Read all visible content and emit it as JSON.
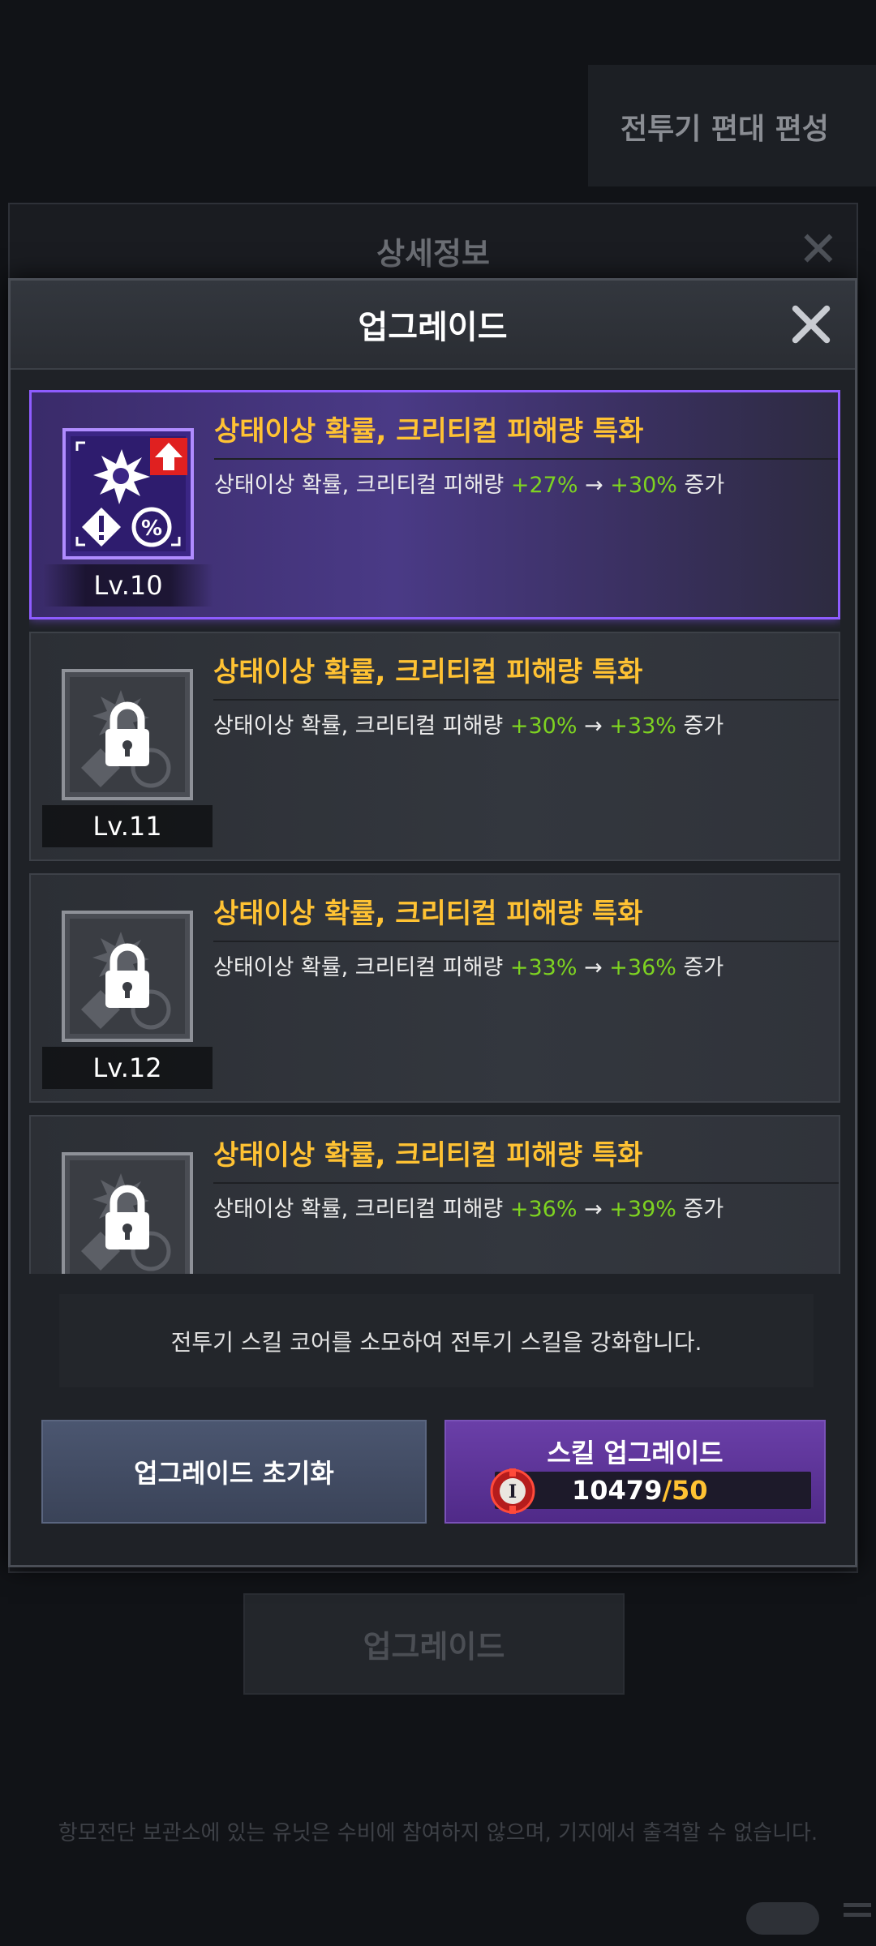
{
  "background": {
    "tabs": [
      "전투기 편대 편성"
    ],
    "detail_title": "상세정보",
    "upgrade_button": "업그레이드",
    "footer_note": "항모전단 보관소에 있는 유닛은 수비에 참여하지 않으며, 기지에서 출격할 수 없습니다."
  },
  "modal": {
    "title": "업그레이드",
    "cards": [
      {
        "title": "상태이상 확률, 크리티컬 피해량 특화",
        "desc_prefix": "상태이상 확률, 크리티컬 피해량 ",
        "from": "+27%",
        "arrow": "→",
        "to": "+30%",
        "desc_suffix": " 증가",
        "level": "Lv.10",
        "state": "unlocked"
      },
      {
        "title": "상태이상 확률, 크리티컬 피해량 특화",
        "desc_prefix": "상태이상 확률, 크리티컬 피해량 ",
        "from": "+30%",
        "arrow": "→",
        "to": "+33%",
        "desc_suffix": " 증가",
        "level": "Lv.11",
        "state": "locked"
      },
      {
        "title": "상태이상 확률, 크리티컬 피해량 특화",
        "desc_prefix": "상태이상 확률, 크리티컬 피해량 ",
        "from": "+33%",
        "arrow": "→",
        "to": "+36%",
        "desc_suffix": " 증가",
        "level": "Lv.12",
        "state": "locked"
      },
      {
        "title": "상태이상 확률, 크리티컬 피해량 특화",
        "desc_prefix": "상태이상 확률, 크리티컬 피해량 ",
        "from": "+36%",
        "arrow": "→",
        "to": "+39%",
        "desc_suffix": " 증가",
        "level": "",
        "state": "locked"
      }
    ],
    "notice": "전투기 스킬 코어를 소모하여 전투기 스킬을 강화합니다.",
    "reset_button": "업그레이드 초기화",
    "upgrade_button": {
      "label": "스킬 업그레이드",
      "owned": "10479",
      "separator": "/",
      "required": "50",
      "icon": "skill-core-icon"
    }
  },
  "colors": {
    "title_gold": "#ffc233",
    "value_green": "#7ed321",
    "active_border": "#8e5cff",
    "upgrade_purple": "#6a3fa8",
    "reset_blue": "#4b5670"
  }
}
